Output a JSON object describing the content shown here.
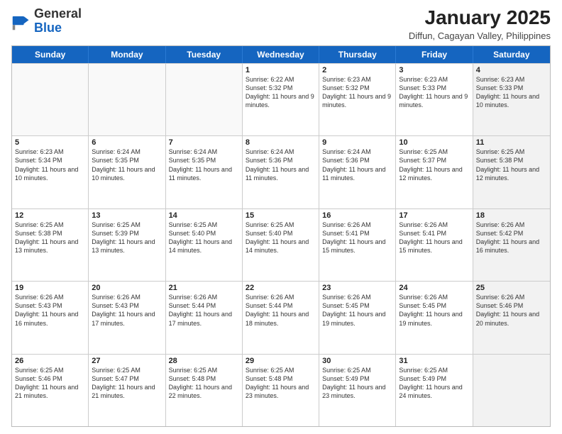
{
  "header": {
    "logo_general": "General",
    "logo_blue": "Blue",
    "month_title": "January 2025",
    "subtitle": "Diffun, Cagayan Valley, Philippines"
  },
  "weekdays": [
    "Sunday",
    "Monday",
    "Tuesday",
    "Wednesday",
    "Thursday",
    "Friday",
    "Saturday"
  ],
  "weeks": [
    [
      {
        "day": "",
        "sunrise": "",
        "sunset": "",
        "daylight": "",
        "shaded": false,
        "empty": true
      },
      {
        "day": "",
        "sunrise": "",
        "sunset": "",
        "daylight": "",
        "shaded": false,
        "empty": true
      },
      {
        "day": "",
        "sunrise": "",
        "sunset": "",
        "daylight": "",
        "shaded": false,
        "empty": true
      },
      {
        "day": "1",
        "sunrise": "Sunrise: 6:22 AM",
        "sunset": "Sunset: 5:32 PM",
        "daylight": "Daylight: 11 hours and 9 minutes.",
        "shaded": false,
        "empty": false
      },
      {
        "day": "2",
        "sunrise": "Sunrise: 6:23 AM",
        "sunset": "Sunset: 5:32 PM",
        "daylight": "Daylight: 11 hours and 9 minutes.",
        "shaded": false,
        "empty": false
      },
      {
        "day": "3",
        "sunrise": "Sunrise: 6:23 AM",
        "sunset": "Sunset: 5:33 PM",
        "daylight": "Daylight: 11 hours and 9 minutes.",
        "shaded": false,
        "empty": false
      },
      {
        "day": "4",
        "sunrise": "Sunrise: 6:23 AM",
        "sunset": "Sunset: 5:33 PM",
        "daylight": "Daylight: 11 hours and 10 minutes.",
        "shaded": true,
        "empty": false
      }
    ],
    [
      {
        "day": "5",
        "sunrise": "Sunrise: 6:23 AM",
        "sunset": "Sunset: 5:34 PM",
        "daylight": "Daylight: 11 hours and 10 minutes.",
        "shaded": false,
        "empty": false
      },
      {
        "day": "6",
        "sunrise": "Sunrise: 6:24 AM",
        "sunset": "Sunset: 5:35 PM",
        "daylight": "Daylight: 11 hours and 10 minutes.",
        "shaded": false,
        "empty": false
      },
      {
        "day": "7",
        "sunrise": "Sunrise: 6:24 AM",
        "sunset": "Sunset: 5:35 PM",
        "daylight": "Daylight: 11 hours and 11 minutes.",
        "shaded": false,
        "empty": false
      },
      {
        "day": "8",
        "sunrise": "Sunrise: 6:24 AM",
        "sunset": "Sunset: 5:36 PM",
        "daylight": "Daylight: 11 hours and 11 minutes.",
        "shaded": false,
        "empty": false
      },
      {
        "day": "9",
        "sunrise": "Sunrise: 6:24 AM",
        "sunset": "Sunset: 5:36 PM",
        "daylight": "Daylight: 11 hours and 11 minutes.",
        "shaded": false,
        "empty": false
      },
      {
        "day": "10",
        "sunrise": "Sunrise: 6:25 AM",
        "sunset": "Sunset: 5:37 PM",
        "daylight": "Daylight: 11 hours and 12 minutes.",
        "shaded": false,
        "empty": false
      },
      {
        "day": "11",
        "sunrise": "Sunrise: 6:25 AM",
        "sunset": "Sunset: 5:38 PM",
        "daylight": "Daylight: 11 hours and 12 minutes.",
        "shaded": true,
        "empty": false
      }
    ],
    [
      {
        "day": "12",
        "sunrise": "Sunrise: 6:25 AM",
        "sunset": "Sunset: 5:38 PM",
        "daylight": "Daylight: 11 hours and 13 minutes.",
        "shaded": false,
        "empty": false
      },
      {
        "day": "13",
        "sunrise": "Sunrise: 6:25 AM",
        "sunset": "Sunset: 5:39 PM",
        "daylight": "Daylight: 11 hours and 13 minutes.",
        "shaded": false,
        "empty": false
      },
      {
        "day": "14",
        "sunrise": "Sunrise: 6:25 AM",
        "sunset": "Sunset: 5:40 PM",
        "daylight": "Daylight: 11 hours and 14 minutes.",
        "shaded": false,
        "empty": false
      },
      {
        "day": "15",
        "sunrise": "Sunrise: 6:25 AM",
        "sunset": "Sunset: 5:40 PM",
        "daylight": "Daylight: 11 hours and 14 minutes.",
        "shaded": false,
        "empty": false
      },
      {
        "day": "16",
        "sunrise": "Sunrise: 6:26 AM",
        "sunset": "Sunset: 5:41 PM",
        "daylight": "Daylight: 11 hours and 15 minutes.",
        "shaded": false,
        "empty": false
      },
      {
        "day": "17",
        "sunrise": "Sunrise: 6:26 AM",
        "sunset": "Sunset: 5:41 PM",
        "daylight": "Daylight: 11 hours and 15 minutes.",
        "shaded": false,
        "empty": false
      },
      {
        "day": "18",
        "sunrise": "Sunrise: 6:26 AM",
        "sunset": "Sunset: 5:42 PM",
        "daylight": "Daylight: 11 hours and 16 minutes.",
        "shaded": true,
        "empty": false
      }
    ],
    [
      {
        "day": "19",
        "sunrise": "Sunrise: 6:26 AM",
        "sunset": "Sunset: 5:43 PM",
        "daylight": "Daylight: 11 hours and 16 minutes.",
        "shaded": false,
        "empty": false
      },
      {
        "day": "20",
        "sunrise": "Sunrise: 6:26 AM",
        "sunset": "Sunset: 5:43 PM",
        "daylight": "Daylight: 11 hours and 17 minutes.",
        "shaded": false,
        "empty": false
      },
      {
        "day": "21",
        "sunrise": "Sunrise: 6:26 AM",
        "sunset": "Sunset: 5:44 PM",
        "daylight": "Daylight: 11 hours and 17 minutes.",
        "shaded": false,
        "empty": false
      },
      {
        "day": "22",
        "sunrise": "Sunrise: 6:26 AM",
        "sunset": "Sunset: 5:44 PM",
        "daylight": "Daylight: 11 hours and 18 minutes.",
        "shaded": false,
        "empty": false
      },
      {
        "day": "23",
        "sunrise": "Sunrise: 6:26 AM",
        "sunset": "Sunset: 5:45 PM",
        "daylight": "Daylight: 11 hours and 19 minutes.",
        "shaded": false,
        "empty": false
      },
      {
        "day": "24",
        "sunrise": "Sunrise: 6:26 AM",
        "sunset": "Sunset: 5:45 PM",
        "daylight": "Daylight: 11 hours and 19 minutes.",
        "shaded": false,
        "empty": false
      },
      {
        "day": "25",
        "sunrise": "Sunrise: 6:26 AM",
        "sunset": "Sunset: 5:46 PM",
        "daylight": "Daylight: 11 hours and 20 minutes.",
        "shaded": true,
        "empty": false
      }
    ],
    [
      {
        "day": "26",
        "sunrise": "Sunrise: 6:25 AM",
        "sunset": "Sunset: 5:46 PM",
        "daylight": "Daylight: 11 hours and 21 minutes.",
        "shaded": false,
        "empty": false
      },
      {
        "day": "27",
        "sunrise": "Sunrise: 6:25 AM",
        "sunset": "Sunset: 5:47 PM",
        "daylight": "Daylight: 11 hours and 21 minutes.",
        "shaded": false,
        "empty": false
      },
      {
        "day": "28",
        "sunrise": "Sunrise: 6:25 AM",
        "sunset": "Sunset: 5:48 PM",
        "daylight": "Daylight: 11 hours and 22 minutes.",
        "shaded": false,
        "empty": false
      },
      {
        "day": "29",
        "sunrise": "Sunrise: 6:25 AM",
        "sunset": "Sunset: 5:48 PM",
        "daylight": "Daylight: 11 hours and 23 minutes.",
        "shaded": false,
        "empty": false
      },
      {
        "day": "30",
        "sunrise": "Sunrise: 6:25 AM",
        "sunset": "Sunset: 5:49 PM",
        "daylight": "Daylight: 11 hours and 23 minutes.",
        "shaded": false,
        "empty": false
      },
      {
        "day": "31",
        "sunrise": "Sunrise: 6:25 AM",
        "sunset": "Sunset: 5:49 PM",
        "daylight": "Daylight: 11 hours and 24 minutes.",
        "shaded": false,
        "empty": false
      },
      {
        "day": "",
        "sunrise": "",
        "sunset": "",
        "daylight": "",
        "shaded": true,
        "empty": true
      }
    ]
  ]
}
